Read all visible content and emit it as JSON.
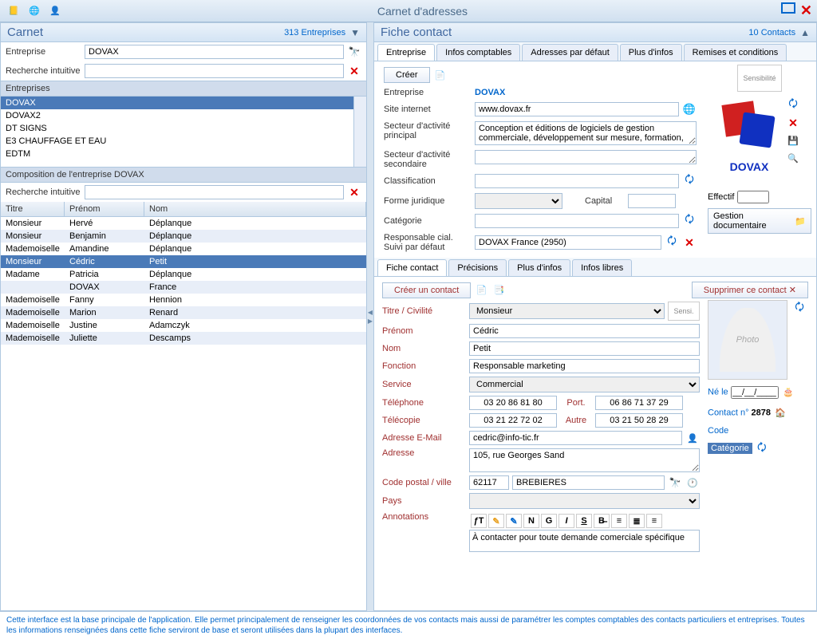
{
  "titlebar": {
    "title": "Carnet d'adresses"
  },
  "left": {
    "header_title": "Carnet",
    "count_link": "313 Entreprises",
    "search_entreprise_label": "Entreprise",
    "search_entreprise_value": "DOVAX",
    "search_intuitive_label": "Recherche intuitive",
    "entreprises_header": "Entreprises",
    "entreprises": [
      "DOVAX",
      "DOVAX2",
      "DT SIGNS",
      "E3 CHAUFFAGE ET EAU",
      "EDTM"
    ],
    "entreprises_selected_index": 0,
    "composition_header": "Composition de l'entreprise DOVAX",
    "search_intuitive2_label": "Recherche intuitive",
    "grid_headers": {
      "titre": "Titre",
      "prenom": "Prénom",
      "nom": "Nom"
    },
    "contacts": [
      {
        "titre": "Monsieur",
        "prenom": "Hervé",
        "nom": "Déplanque"
      },
      {
        "titre": "Monsieur",
        "prenom": "Benjamin",
        "nom": "Déplanque"
      },
      {
        "titre": "Mademoiselle",
        "prenom": "Amandine",
        "nom": "Déplanque"
      },
      {
        "titre": "Monsieur",
        "prenom": "Cédric",
        "nom": "Petit"
      },
      {
        "titre": "Madame",
        "prenom": "Patricia",
        "nom": "Déplanque"
      },
      {
        "titre": "",
        "prenom": "DOVAX",
        "nom": "France"
      },
      {
        "titre": "Mademoiselle",
        "prenom": "Fanny",
        "nom": "Hennion"
      },
      {
        "titre": "Mademoiselle",
        "prenom": "Marion",
        "nom": "Renard"
      },
      {
        "titre": "Mademoiselle",
        "prenom": "Justine",
        "nom": "Adamczyk"
      },
      {
        "titre": "Mademoiselle",
        "prenom": "Juliette",
        "nom": "Descamps"
      }
    ],
    "contacts_selected_index": 3
  },
  "right": {
    "header_title": "Fiche contact",
    "count_link": "10 Contacts",
    "ent_tabs": [
      "Entreprise",
      "Infos comptables",
      "Adresses par défaut",
      "Plus d'infos",
      "Remises et conditions"
    ],
    "ent_active_tab": 0,
    "creer_btn": "Créer",
    "sensibilite_label": "Sensibilité",
    "ent": {
      "entreprise_label": "Entreprise",
      "entreprise_value": "DOVAX",
      "site_label": "Site internet",
      "site_value": "www.dovax.fr",
      "secteur1_label": "Secteur d'activité principal",
      "secteur1_value": "Conception et éditions de logiciels de gestion commerciale, développement sur mesure, formation,",
      "secteur2_label": "Secteur d'activité secondaire",
      "secteur2_value": "",
      "classif_label": "Classification",
      "classif_value": "",
      "forme_label": "Forme juridique",
      "forme_value": "",
      "capital_label": "Capital",
      "capital_value": "",
      "effectif_label": "Effectif",
      "effectif_value": "",
      "categorie_label": "Catégorie",
      "categorie_value": "",
      "resp_label": "Responsable cial. Suivi par défaut",
      "resp_value": "DOVAX France (2950)",
      "logo_alt": "DOVAX",
      "gestion_doc_btn": "Gestion documentaire"
    },
    "fc_tabs": [
      "Fiche contact",
      "Précisions",
      "Plus d'infos",
      "Infos libres"
    ],
    "fc_active_tab": 0,
    "fc_buttons": {
      "creer": "Créer un contact",
      "supprimer": "Supprimer ce contact"
    },
    "fc_sensi": "Sensi.",
    "fc": {
      "titre_label": "Titre / Civilité",
      "titre_value": "Monsieur",
      "prenom_label": "Prénom",
      "prenom_value": "Cédric",
      "nom_label": "Nom",
      "nom_value": "Petit",
      "fonction_label": "Fonction",
      "fonction_value": "Responsable marketing",
      "service_label": "Service",
      "service_value": "Commercial",
      "tel_label": "Téléphone",
      "tel_value": "03 20 86 81 80",
      "port_label": "Port.",
      "port_value": "06 86 71 37 29",
      "fax_label": "Télécopie",
      "fax_value": "03 21 22 72 02",
      "autre_label": "Autre",
      "autre_value": "03 21 50 28 29",
      "email_label": "Adresse E-Mail",
      "email_value": "cedric@info-tic.fr",
      "adresse_label": "Adresse",
      "adresse_value": "105, rue Georges Sand",
      "cp_label": "Code postal / ville",
      "cp_value": "62117",
      "ville_value": "BREBIERES",
      "pays_label": "Pays",
      "pays_value": "",
      "annot_label": "Annotations",
      "annot_value": "À contacter pour toute demande comerciale spécifique"
    },
    "contact_meta": {
      "ne_le_label": "Né le",
      "ne_le_value": "__/__/____",
      "contact_no_label": "Contact n°",
      "contact_no_value": "2878",
      "code_label": "Code",
      "categorie_label": "Catégorie"
    },
    "photo_placeholder": "Photo"
  },
  "footer": "Cette interface est la base principale de l'application. Elle permet principalement de renseigner les coordonnées de vos contacts mais aussi de paramétrer les comptes comptables des contacts particuliers et entreprises. Toutes les informations renseignées dans cette fiche serviront de base et seront utilisées dans la plupart des interfaces."
}
